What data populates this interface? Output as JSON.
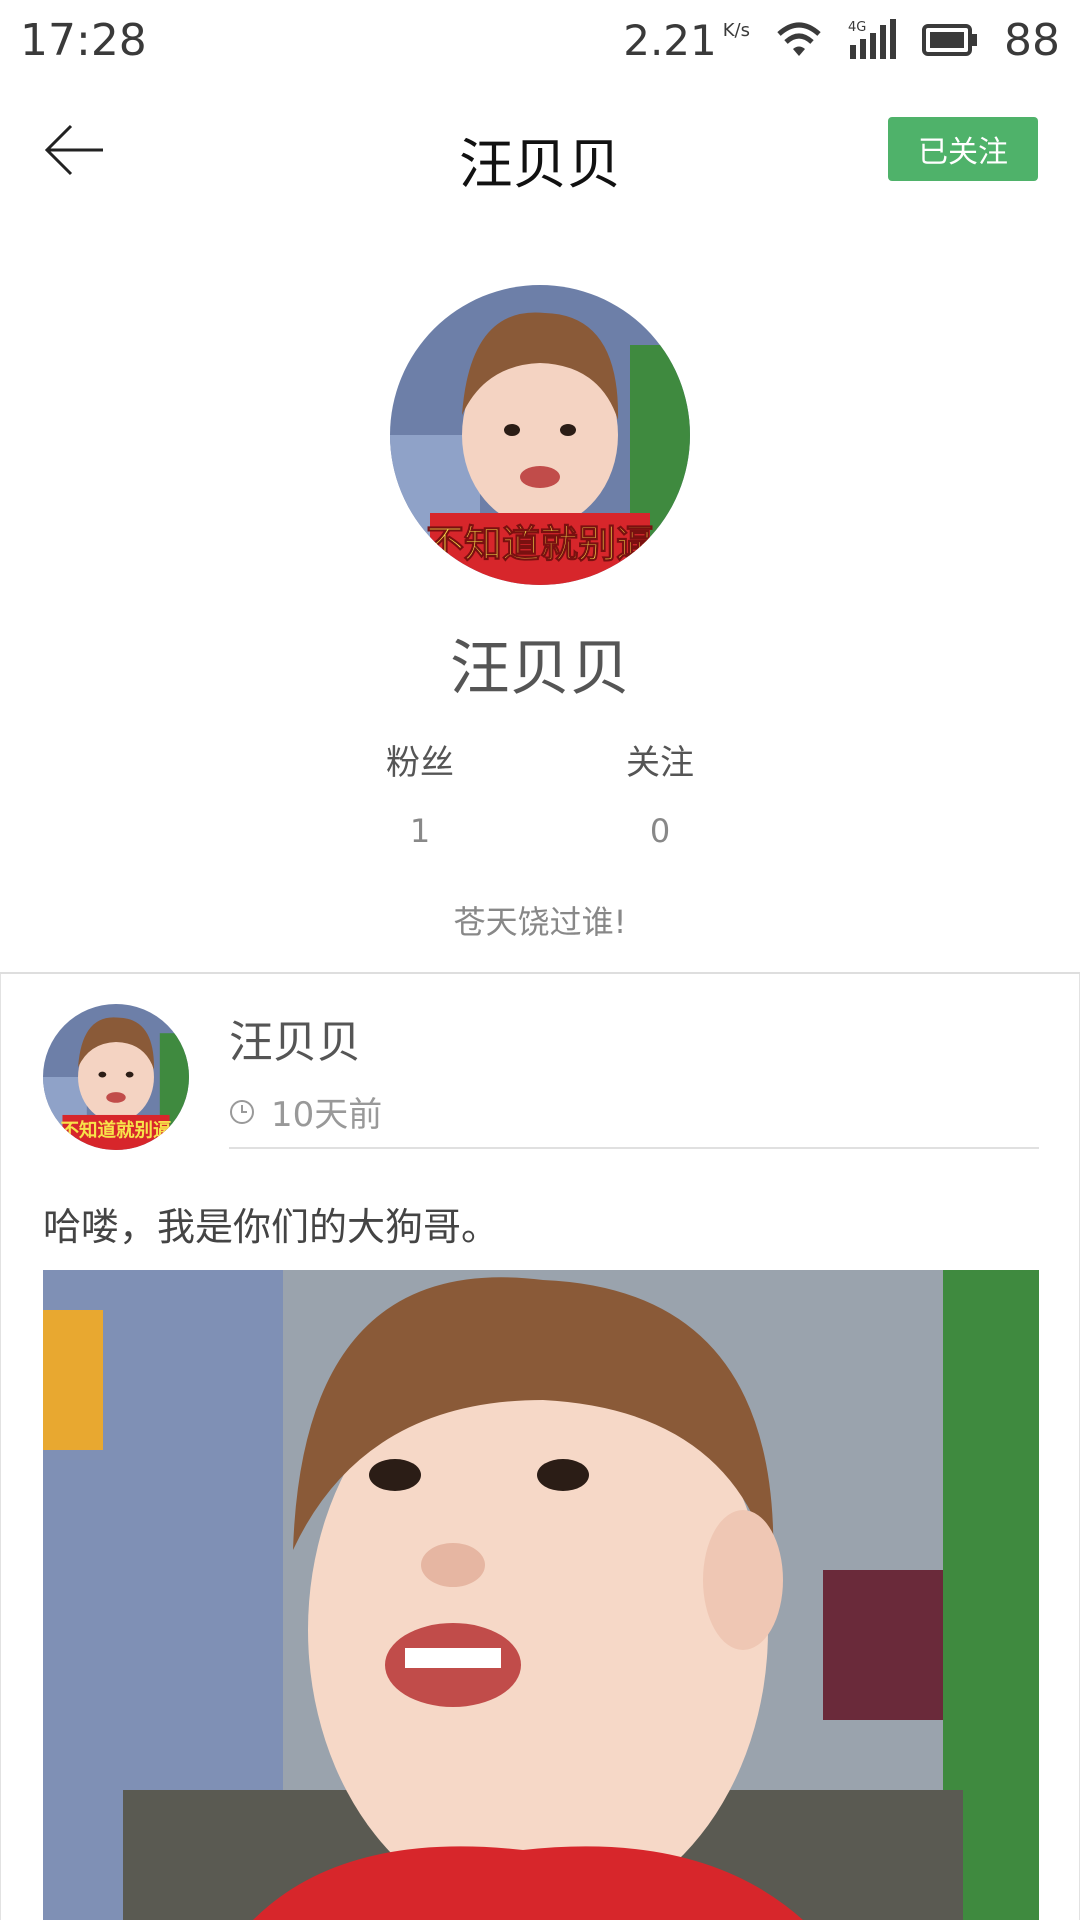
{
  "status_bar": {
    "time": "17:28",
    "speed": "2.21",
    "speed_unit": "K/s",
    "network": "4G",
    "battery": "88"
  },
  "nav": {
    "title": "汪贝贝",
    "follow_label": "已关注",
    "accent_color": "#4fb26a"
  },
  "profile": {
    "name": "汪贝贝",
    "avatar_caption": "不知道就别逼",
    "stats": [
      {
        "label": "粉丝",
        "value": "1"
      },
      {
        "label": "关注",
        "value": "0"
      }
    ],
    "bio": "苍天饶过谁!"
  },
  "post": {
    "author": "汪贝贝",
    "time": "10天前",
    "avatar_caption": "不知道就别逼",
    "text": "哈喽，我是你们的大狗哥。"
  }
}
